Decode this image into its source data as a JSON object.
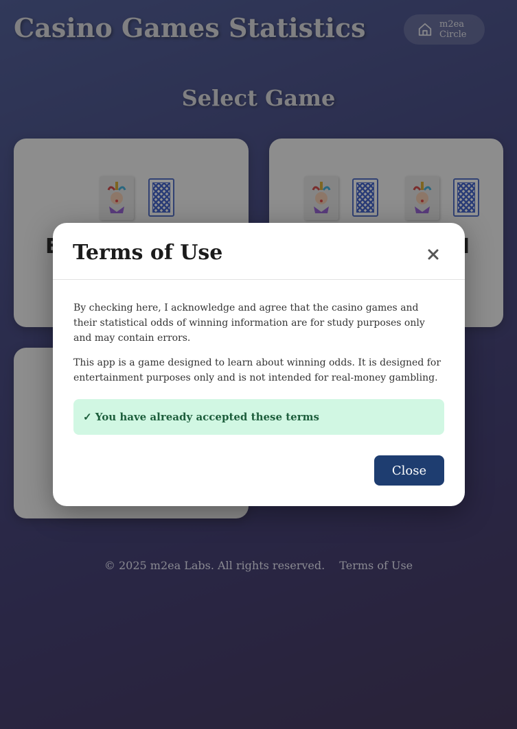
{
  "header": {
    "title": "Casino Games Statistics",
    "circle_label": "m2ea Circle"
  },
  "main": {
    "section_title": "Select Game",
    "games": [
      {
        "name_partial": "E"
      },
      {
        "name_partial": "I"
      },
      {
        "name_partial": ""
      }
    ]
  },
  "footer": {
    "copyright": "© 2025 m2ea Labs. All rights reserved.",
    "terms_link": "Terms of Use"
  },
  "modal": {
    "title": "Terms of Use",
    "paragraph1": "By checking here, I acknowledge and agree that the casino games and their statistical odds of winning information are for study purposes only and may contain errors.",
    "paragraph2": "This app is a game designed to learn about winning odds. It is designed for entertainment purposes only and is not intended for real-money gambling.",
    "accepted_text": "✓ You have already accepted these terms",
    "close_button": "Close"
  },
  "colors": {
    "accent": "#1e3d70",
    "success_bg": "#d1f7e3",
    "success_text": "#1d5e3c"
  }
}
